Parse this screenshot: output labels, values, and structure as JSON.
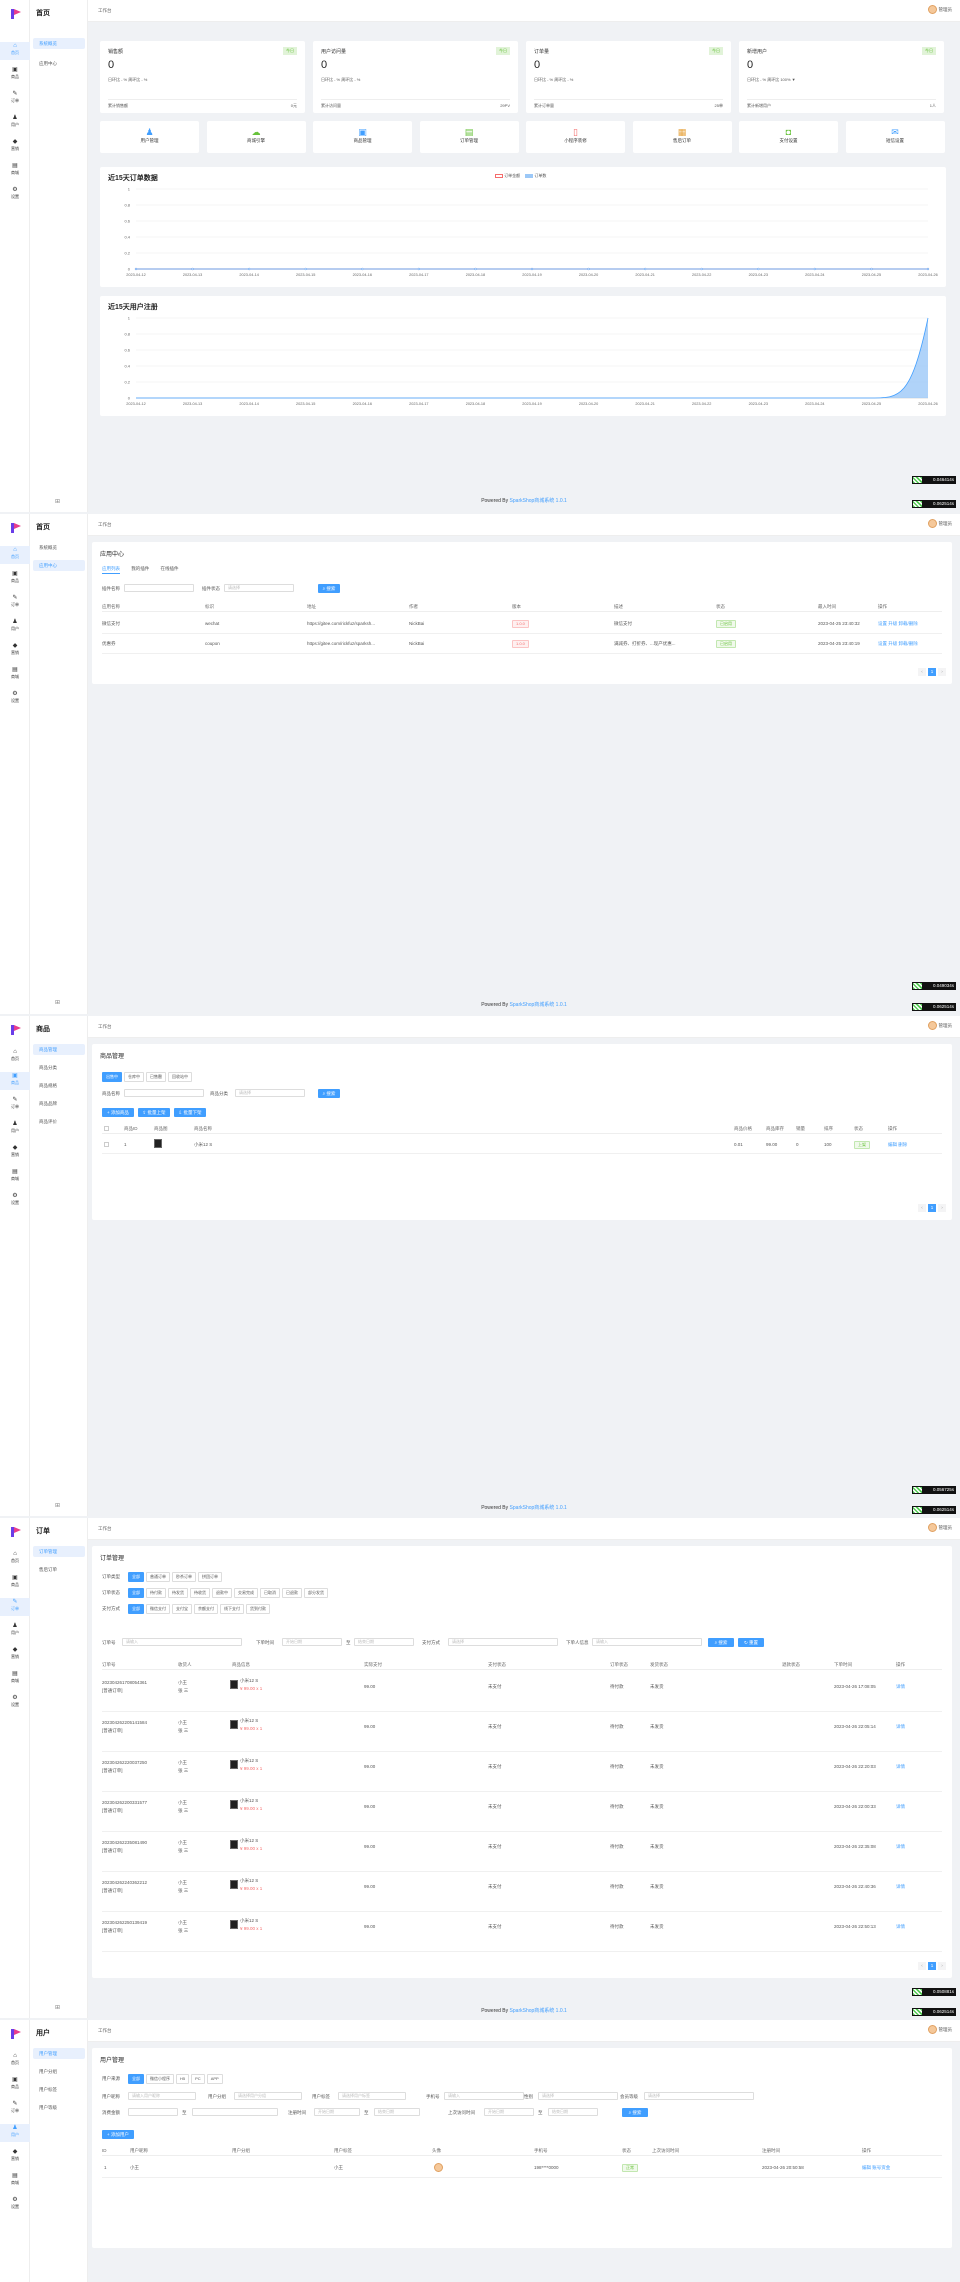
{
  "nav": {
    "items": [
      {
        "label": "首页",
        "icon": "home-icon"
      },
      {
        "label": "商品",
        "icon": "goods-icon"
      },
      {
        "label": "订单",
        "icon": "order-icon"
      },
      {
        "label": "用户",
        "icon": "user-icon"
      },
      {
        "label": "营销",
        "icon": "marketing-icon"
      },
      {
        "label": "商城",
        "icon": "shop-icon"
      },
      {
        "label": "设置",
        "icon": "gear-icon"
      }
    ]
  },
  "header": {
    "breadcrumb": "工作台",
    "admin": "管理员"
  },
  "footer": {
    "powered": "Powered By ",
    "brand": "SparkShop商城系统 1.0.1"
  },
  "perf": [
    "0.046414s",
    "0.062514s",
    "0.049034s",
    "0.062514s",
    "0.056725s",
    "0.062514s",
    "0.050881s",
    "0.062514s"
  ],
  "home": {
    "sub_title": "首页",
    "sub_items": [
      "系统概览",
      "应用中心"
    ],
    "stats": [
      {
        "title": "销售额",
        "badge": "今日",
        "value": "0",
        "compare": "日环比 - %    周环比 - %",
        "foot_label": "累计销售额",
        "foot_value": "0元"
      },
      {
        "title": "用户访问量",
        "badge": "今日",
        "value": "0",
        "compare": "日环比 - %    周环比 - %",
        "foot_label": "累计访问量",
        "foot_value": "29PV"
      },
      {
        "title": "订单量",
        "badge": "今日",
        "value": "0",
        "compare": "日环比 - %    周环比 - %",
        "foot_label": "累计订单量",
        "foot_value": "25单"
      },
      {
        "title": "新增用户",
        "badge": "今日",
        "value": "0",
        "compare": "日环比 - %    周环比 100% ▼",
        "foot_label": "累计新增用户",
        "foot_value": "1人"
      }
    ],
    "quick": [
      {
        "label": "用户管理",
        "icon": "user-icon",
        "color": "#409eff"
      },
      {
        "label": "商城引擎",
        "icon": "cloud-icon",
        "color": "#67c23a"
      },
      {
        "label": "商品管理",
        "icon": "bag-icon",
        "color": "#409eff"
      },
      {
        "label": "订单管理",
        "icon": "document-icon",
        "color": "#67c23a"
      },
      {
        "label": "小程序装修",
        "icon": "phone-icon",
        "color": "#f56c6c"
      },
      {
        "label": "售后订单",
        "icon": "clipboard-icon",
        "color": "#e6a23c"
      },
      {
        "label": "支付设置",
        "icon": "wallet-icon",
        "color": "#67c23a"
      },
      {
        "label": "短信设置",
        "icon": "mail-icon",
        "color": "#409eff"
      }
    ]
  },
  "chart_data": [
    {
      "type": "line",
      "title": "近15天订单数据",
      "legend": [
        "订单金额",
        "订单数"
      ],
      "legend_position": "top-right",
      "x": [
        "2023-04-12",
        "2023-04-13",
        "2023-04-14",
        "2023-04-15",
        "2023-04-16",
        "2023-04-17",
        "2023-04-18",
        "2023-04-19",
        "2023-04-20",
        "2023-04-21",
        "2023-04-22",
        "2023-04-23",
        "2023-04-24",
        "2023-04-25",
        "2023-04-26"
      ],
      "y_ticks": [
        "1",
        "0.8",
        "0.6",
        "0.4",
        "0.2",
        "0"
      ],
      "ylim": [
        0,
        1
      ],
      "series": [
        {
          "name": "订单金额",
          "color": "#f56c6c",
          "values": [
            0,
            0,
            0,
            0,
            0,
            0,
            0,
            0,
            0,
            0,
            0,
            0,
            0,
            0,
            0
          ]
        },
        {
          "name": "订单数",
          "color": "#409eff",
          "values": [
            0,
            0,
            0,
            0,
            0,
            0,
            0,
            0,
            0,
            0,
            0,
            0,
            0,
            0,
            0
          ]
        }
      ],
      "grid": true
    },
    {
      "type": "area",
      "title": "近15天用户注册",
      "x": [
        "2023-04-12",
        "2023-04-13",
        "2023-04-14",
        "2023-04-15",
        "2023-04-16",
        "2023-04-17",
        "2023-04-18",
        "2023-04-19",
        "2023-04-20",
        "2023-04-21",
        "2023-04-22",
        "2023-04-23",
        "2023-04-24",
        "2023-04-25",
        "2023-04-26"
      ],
      "y_ticks": [
        "1",
        "0.8",
        "0.6",
        "0.4",
        "0.2",
        "0"
      ],
      "ylim": [
        0,
        1
      ],
      "series": [
        {
          "name": "",
          "color": "#409eff",
          "values": [
            0,
            0,
            0,
            0,
            0,
            0,
            0,
            0,
            0,
            0,
            0,
            0,
            0,
            0,
            1
          ]
        }
      ],
      "grid": true
    }
  ],
  "apps": {
    "sub_title": "首页",
    "sub_items": [
      "系统概览",
      "应用中心"
    ],
    "card_title": "应用中心",
    "tabs": [
      "应用列表",
      "我的插件",
      "在线插件"
    ],
    "search_label": "插件名称",
    "status_label": "插件状态",
    "status_placeholder": "请选择",
    "search_btn": "搜索",
    "columns": [
      "应用名称",
      "标识",
      "地址",
      "作者",
      "版本",
      "描述",
      "状态",
      "最入时间",
      "操作"
    ],
    "rows": [
      {
        "name": "微信支付",
        "key": "wechat",
        "url": "https://gitee.com/rickfuz/sparksh...",
        "author": "NickBai",
        "version": "1.0.0",
        "desc": "微信支付",
        "status": "已启用",
        "time": "2023-04-25 23:40:32",
        "ops": "设置  升级  卸载/删除"
      },
      {
        "name": "优惠券",
        "key": "coupon",
        "url": "https://gitee.com/rickfuz/sparksh...",
        "author": "NickBai",
        "version": "1.0.0",
        "desc": "满减券、打折券、...现产优惠...",
        "status": "已启用",
        "time": "2023-04-25 23:40:19",
        "ops": "设置  升级  卸载/删除"
      }
    ],
    "page": "1"
  },
  "goods": {
    "sub_title": "商品",
    "sub_items": [
      "商品管理",
      "商品分类",
      "商品规格",
      "商品品牌",
      "商品评价"
    ],
    "card_title": "商品管理",
    "filter_chips": [
      "出售中",
      "仓库中",
      "已售罄",
      "回收站中"
    ],
    "name_label": "商品名称",
    "cat_label": "商品分类",
    "cat_placeholder": "请选择",
    "search_btn": "搜索",
    "action_btns": [
      "添加商品",
      "批量上架",
      "批量下架"
    ],
    "columns": [
      "商品ID",
      "商品图",
      "商品名称",
      "商品价格",
      "商品库存",
      "销量",
      "排序",
      "状态",
      "操作"
    ],
    "row": {
      "id": "1",
      "name": "小米12 S",
      "price": "0.01",
      "stock": "99.00",
      "sales": "0",
      "sort": "100",
      "status": "上架",
      "ops": "编辑  删除"
    },
    "page": "1"
  },
  "orders": {
    "sub_title": "订单",
    "sub_items": [
      "订单管理",
      "售后订单"
    ],
    "card_title": "订单管理",
    "filter_rows": [
      {
        "label": "订单类型",
        "chips": [
          "全部",
          "普通订单",
          "秒杀订单",
          "拼团订单"
        ]
      },
      {
        "label": "订单状态",
        "chips": [
          "全部",
          "待付款",
          "待发货",
          "待收货",
          "退款中",
          "交易完成",
          "已取消",
          "已退款",
          "部分发货"
        ]
      },
      {
        "label": "支付方式",
        "chips": [
          "全部",
          "微信支付",
          "支付宝",
          "余额支付",
          "线下支付",
          "货到付款"
        ]
      }
    ],
    "search_labels": [
      "订单号",
      "下单时间",
      "至",
      "支付方式",
      "下单人信息"
    ],
    "search_placeholders": [
      "请输入",
      "开始日期",
      "结束日期",
      "请选择",
      "请输入"
    ],
    "search_btn": "搜索",
    "reset_btn": "重置",
    "columns": [
      "订单号",
      "收货人",
      "商品信息",
      "实际支付",
      "支付状态",
      "订单状态",
      "发货状态",
      "退款状态",
      "下单时间",
      "操作"
    ],
    "rows": [
      {
        "no": "202304261708054361",
        "type": "[普通订单]",
        "user": "小王",
        "phone": "张 三",
        "goods": "小米12 S",
        "price": "¥ 99.00 x 1",
        "pay": "99.00",
        "pay_status": "未支付",
        "status": "待付款",
        "ship": "未发货",
        "time": "2023-04-26 17:08:05",
        "op": "详情"
      },
      {
        "no": "202304262205141584",
        "type": "[普通订单]",
        "user": "小王",
        "phone": "张 三",
        "goods": "小米12 S",
        "price": "¥ 99.00 x 1",
        "pay": "99.00",
        "pay_status": "未支付",
        "status": "待付款",
        "ship": "未发货",
        "time": "2023-04-26 22:05:14",
        "op": "详情"
      },
      {
        "no": "202304262220037250",
        "type": "[普通订单]",
        "user": "小王",
        "phone": "张 三",
        "goods": "小米12 S",
        "price": "¥ 99.00 x 1",
        "pay": "99.00",
        "pay_status": "未支付",
        "status": "待付款",
        "ship": "未发货",
        "time": "2023-04-26 22:20:03",
        "op": "详情"
      },
      {
        "no": "202304262200331577",
        "type": "[普通订单]",
        "user": "小王",
        "phone": "张 三",
        "goods": "小米12 S",
        "price": "¥ 99.00 x 1",
        "pay": "99.00",
        "pay_status": "未支付",
        "status": "待付款",
        "ship": "未发货",
        "time": "2023-04-26 22:00:33",
        "op": "详情"
      },
      {
        "no": "202304262235081490",
        "type": "[普通订单]",
        "user": "小王",
        "phone": "张 三",
        "goods": "小米12 S",
        "price": "¥ 99.00 x 1",
        "pay": "99.00",
        "pay_status": "未支付",
        "status": "待付款",
        "ship": "未发货",
        "time": "2023-04-26 22:35:08",
        "op": "详情"
      },
      {
        "no": "202304262240362212",
        "type": "[普通订单]",
        "user": "小王",
        "phone": "张 三",
        "goods": "小米12 S",
        "price": "¥ 99.00 x 1",
        "pay": "99.00",
        "pay_status": "未支付",
        "status": "待付款",
        "ship": "未发货",
        "time": "2023-04-26 22:40:36",
        "op": "详情"
      },
      {
        "no": "202304262250139419",
        "type": "[普通订单]",
        "user": "小王",
        "phone": "张 三",
        "goods": "小米12 S",
        "price": "¥ 99.00 x 1",
        "pay": "99.00",
        "pay_status": "未支付",
        "status": "待付款",
        "ship": "未发货",
        "time": "2023-04-26 22:50:13",
        "op": "详情"
      }
    ],
    "page": "1"
  },
  "users": {
    "sub_title": "用户",
    "sub_items": [
      "用户管理",
      "用户分组",
      "用户标签",
      "用户等级"
    ],
    "card_title": "用户管理",
    "source_label": "用户来源",
    "source_chips": [
      "全部",
      "微信小程序",
      "H5",
      "PC",
      "APP"
    ],
    "filter_labels": [
      "用户昵称",
      "用户分组",
      "用户标签",
      "手机号",
      "性别",
      "会员等级",
      "消费金额",
      "至",
      "注册时间",
      "至",
      "上次访问时间",
      "至"
    ],
    "filter_placeholders": [
      "请输入用户昵称",
      "请选择用户分组",
      "请选择用户标签",
      "请输入",
      "请选择",
      "请选择",
      "开始日期",
      "结束日期",
      "开始日期",
      "结束日期"
    ],
    "search_btn": "搜索",
    "add_btn": "添加用户",
    "columns": [
      "ID",
      "用户昵称",
      "用户分组",
      "用户标签",
      "头像",
      "手机号",
      "状态",
      "上次访问时间",
      "注册时间",
      "操作"
    ],
    "row": {
      "id": "1",
      "nick": "小王",
      "group": "",
      "tag": "小王",
      "phone": "198****0000",
      "status": "正常",
      "last": "",
      "reg": "2023-04-26 20:50:58",
      "ops": "编辑  账号资金"
    }
  }
}
